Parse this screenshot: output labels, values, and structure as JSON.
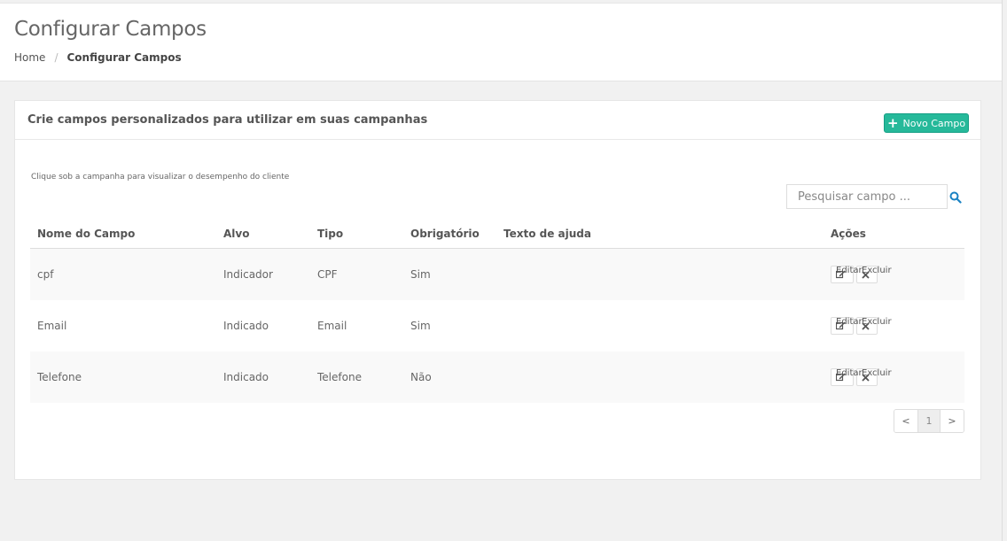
{
  "header": {
    "title": "Configurar Campos",
    "breadcrumb": {
      "home": "Home",
      "separator": "/",
      "current": "Configurar Campos"
    }
  },
  "card": {
    "title": "Crie campos personalizados para utilizar em suas campanhas",
    "new_button_label": "Novo Campo",
    "hint": "Clique sob a campanha para visualizar o desempenho do cliente",
    "search_placeholder": "Pesquisar campo ..."
  },
  "table": {
    "columns": [
      "Nome do Campo",
      "Alvo",
      "Tipo",
      "Obrigatório",
      "Texto de ajuda",
      "Ações"
    ],
    "rows": [
      {
        "nome": "cpf",
        "alvo": "Indicador",
        "tipo": "CPF",
        "obrigatorio": "Sim",
        "ajuda": ""
      },
      {
        "nome": "Email",
        "alvo": "Indicado",
        "tipo": "Email",
        "obrigatorio": "Sim",
        "ajuda": ""
      },
      {
        "nome": "Telefone",
        "alvo": "Indicado",
        "tipo": "Telefone",
        "obrigatorio": "Não",
        "ajuda": ""
      }
    ],
    "edit_label": "Editar",
    "delete_label": "Excluir"
  },
  "pagination": {
    "prev": "<",
    "current": "1",
    "next": ">"
  },
  "colors": {
    "primary": "#26b99a",
    "search_icon": "#1a82c3"
  },
  "icons": {
    "add": "plus-icon",
    "search": "search-icon",
    "edit": "edit-icon",
    "delete": "close-icon"
  }
}
